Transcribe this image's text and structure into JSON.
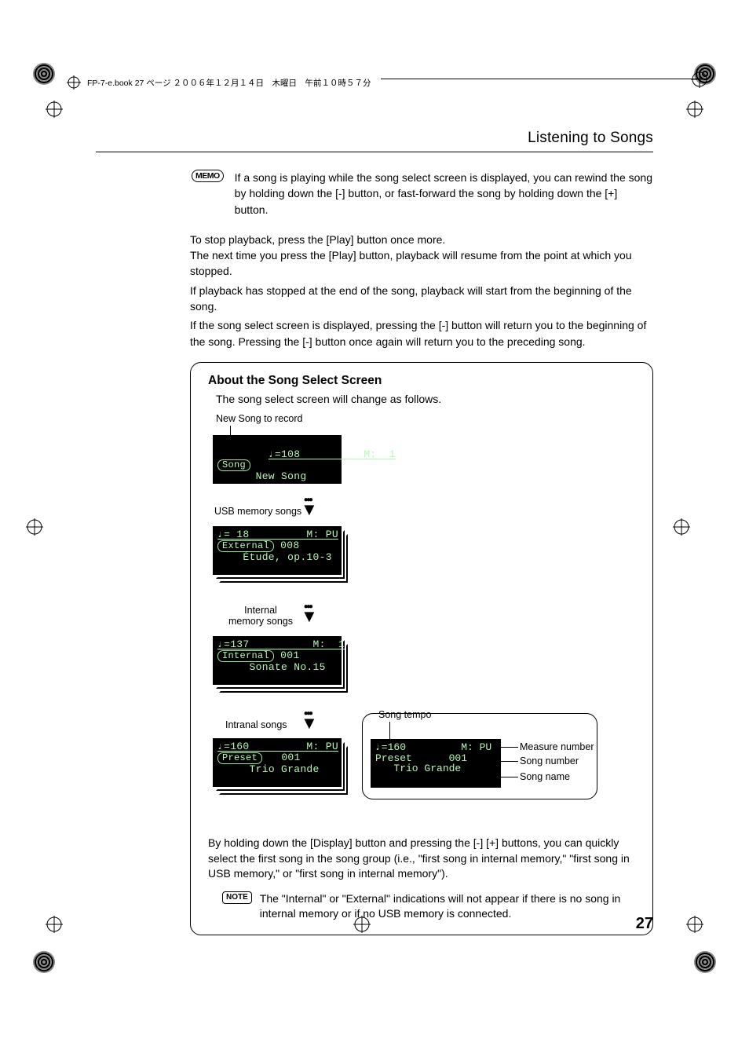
{
  "header": {
    "crop_note": "FP-7-e.book  27 ページ  ２００６年１２月１４日　木曜日　午前１０時５７分"
  },
  "section_title": "Listening to Songs",
  "memo": {
    "badge": "MEMO",
    "text": "If a song is playing while the song select screen is displayed, you can rewind the song by holding down the [-] button, or fast-forward the song by holding down the [+] button."
  },
  "body": {
    "p1": "To stop playback, press the [Play] button once more.",
    "p2": "The next time you press the [Play] button, playback will resume from the point at which you stopped.",
    "p3": "If playback has stopped at the end of the song, playback will start from the beginning of the song.",
    "p4": "If the song select screen is displayed, pressing the [-] button will return you to the beginning of the song. Pressing the [-] button once again will return you to the preceding song."
  },
  "callout": {
    "title": "About the Song Select Screen",
    "sub": "The song select screen will change as follows.",
    "labels": {
      "new_song": "New Song to record",
      "usb": "USB memory songs",
      "internal": "Internal\nmemory songs",
      "intranal": "Intranal songs",
      "song_tempo": "Song tempo",
      "measure": "Measure number",
      "song_number": "Song number",
      "song_name": "Song name"
    },
    "screens": {
      "new": {
        "top": "♩=108          M:  1",
        "badge": "Song",
        "name": "New Song"
      },
      "usb": {
        "top": "♩= 18         M: PU",
        "badge": "External",
        "num": "008",
        "name": "Étude, op.10-3"
      },
      "int": {
        "top": "♩=137          M:  1",
        "badge": "Internal",
        "num": "001",
        "name": "Sonate No.15"
      },
      "pre": {
        "top": "♩=160         M: PU",
        "badge": "Preset",
        "num": "001",
        "name": "Trio Grande"
      },
      "big": {
        "top": "♩=160         M: PU",
        "mid": "Preset      001",
        "name": "Trio Grande"
      }
    },
    "bottom_text": "By holding down the [Display] button and pressing the [-] [+] buttons, you can quickly select the first song in the song group (i.e., \"first song in internal memory,\" \"first song in USB memory,\" or \"first song in internal memory\").",
    "note_badge": "NOTE",
    "note_text": "The \"Internal\" or \"External\" indications will not appear if there is no song in internal memory or if no USB memory is connected."
  },
  "page_number": "27"
}
